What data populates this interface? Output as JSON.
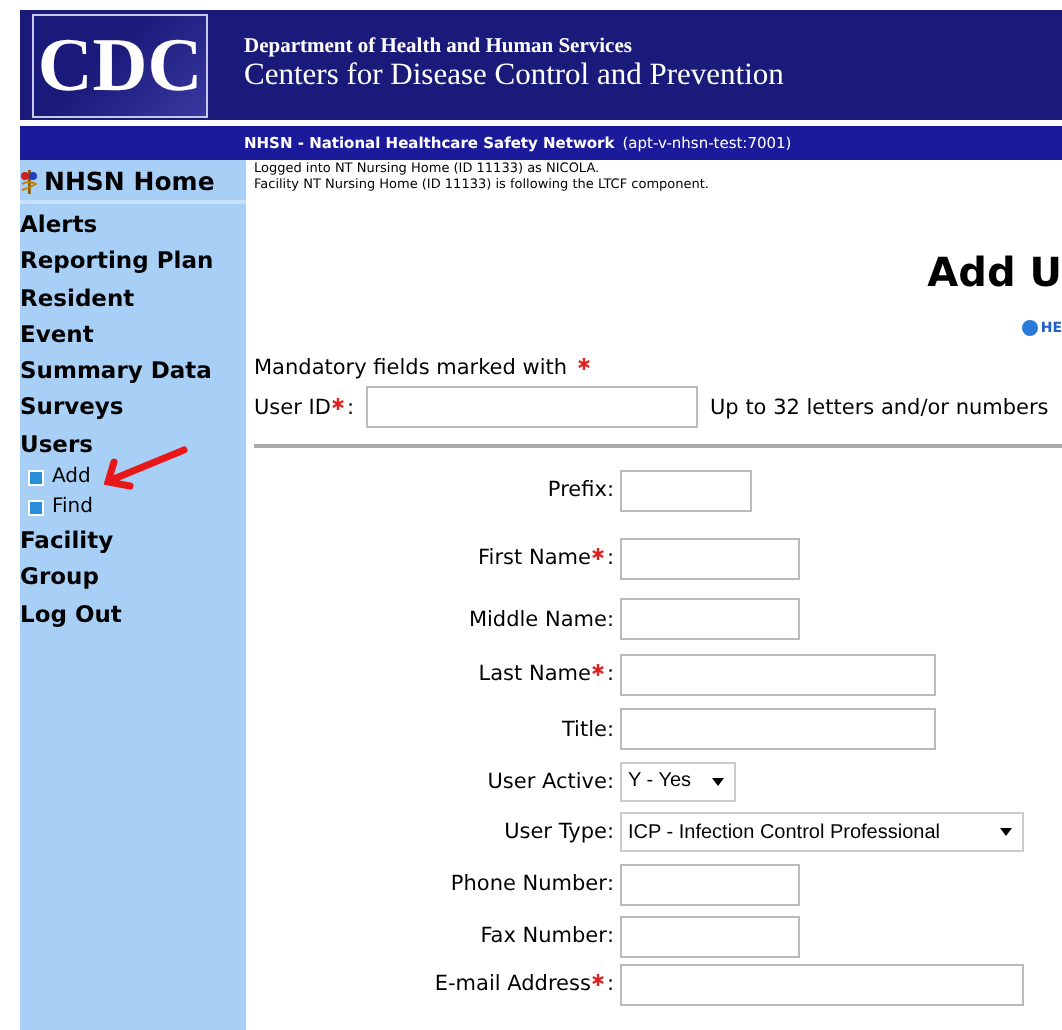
{
  "header": {
    "logo": "CDC",
    "department": "Department of Health and Human Services",
    "agency": "Centers for Disease Control and Prevention"
  },
  "network_bar": {
    "name": "NHSN - National Healthcare Safety Network",
    "server": "(apt-v-nhsn-test:7001)"
  },
  "sidebar": {
    "home": "NHSN Home",
    "items": [
      {
        "label": "Alerts"
      },
      {
        "label": "Reporting Plan"
      },
      {
        "label": "Resident"
      },
      {
        "label": "Event"
      },
      {
        "label": "Summary Data"
      },
      {
        "label": "Surveys"
      },
      {
        "label": "Users",
        "children": [
          {
            "label": "Add"
          },
          {
            "label": "Find"
          }
        ]
      },
      {
        "label": "Facility"
      },
      {
        "label": "Group"
      },
      {
        "label": "Log Out"
      }
    ]
  },
  "login_info": [
    "Logged into NT Nursing Home (ID 11133) as NICOLA.",
    "Facility NT Nursing Home (ID 11133) is following the LTCF component."
  ],
  "page_title": "Add U",
  "help_link": "HE",
  "mandatory_note": "Mandatory fields marked with",
  "user_id": {
    "label": "User ID",
    "required": true,
    "colon": ":",
    "hint": "Up to 32 letters and/or numbers"
  },
  "fields": [
    {
      "label": "Prefix",
      "kind": "text",
      "required": false,
      "colon": ":"
    },
    {
      "label": "First Name",
      "kind": "text",
      "required": true,
      "colon": ":"
    },
    {
      "label": "Middle Name",
      "kind": "text",
      "required": false,
      "colon": ":"
    },
    {
      "label": "Last Name",
      "kind": "text",
      "required": true,
      "colon": ":"
    },
    {
      "label": "Title",
      "kind": "text",
      "required": false,
      "colon": ":"
    },
    {
      "label": "User Active",
      "kind": "select",
      "required": false,
      "colon": ":",
      "value": "Y - Yes"
    },
    {
      "label": "User Type",
      "kind": "select",
      "required": false,
      "colon": ":",
      "value": "ICP - Infection Control Professional"
    },
    {
      "label": "Phone Number",
      "kind": "text",
      "required": false,
      "colon": ":"
    },
    {
      "label": "Fax Number",
      "kind": "text",
      "required": false,
      "colon": ":"
    },
    {
      "label": "E-mail Address",
      "kind": "text",
      "required": true,
      "colon": ":"
    }
  ]
}
